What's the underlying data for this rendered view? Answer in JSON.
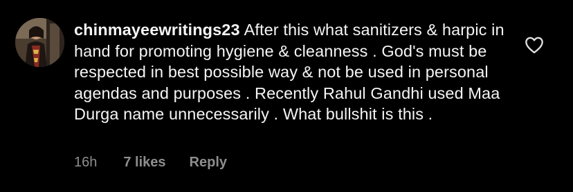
{
  "comment": {
    "username": "chinmayeewritings23",
    "text": "After this what sanitizers & harpic in hand for promoting hygiene & cleanness . God's must be respected in best possible way & not be used in personal agendas and purposes . Recently Rahul Gandhi used Maa Durga name unnecessarily . What bullshit is this .",
    "time": "16h",
    "likes": "7 likes",
    "reply_label": "Reply",
    "avatar_icon": "user-avatar",
    "like_icon": "heart-outline-icon"
  },
  "colors": {
    "background": "#000000",
    "text": "#f5f5f5",
    "secondary": "#8e8e8e"
  }
}
